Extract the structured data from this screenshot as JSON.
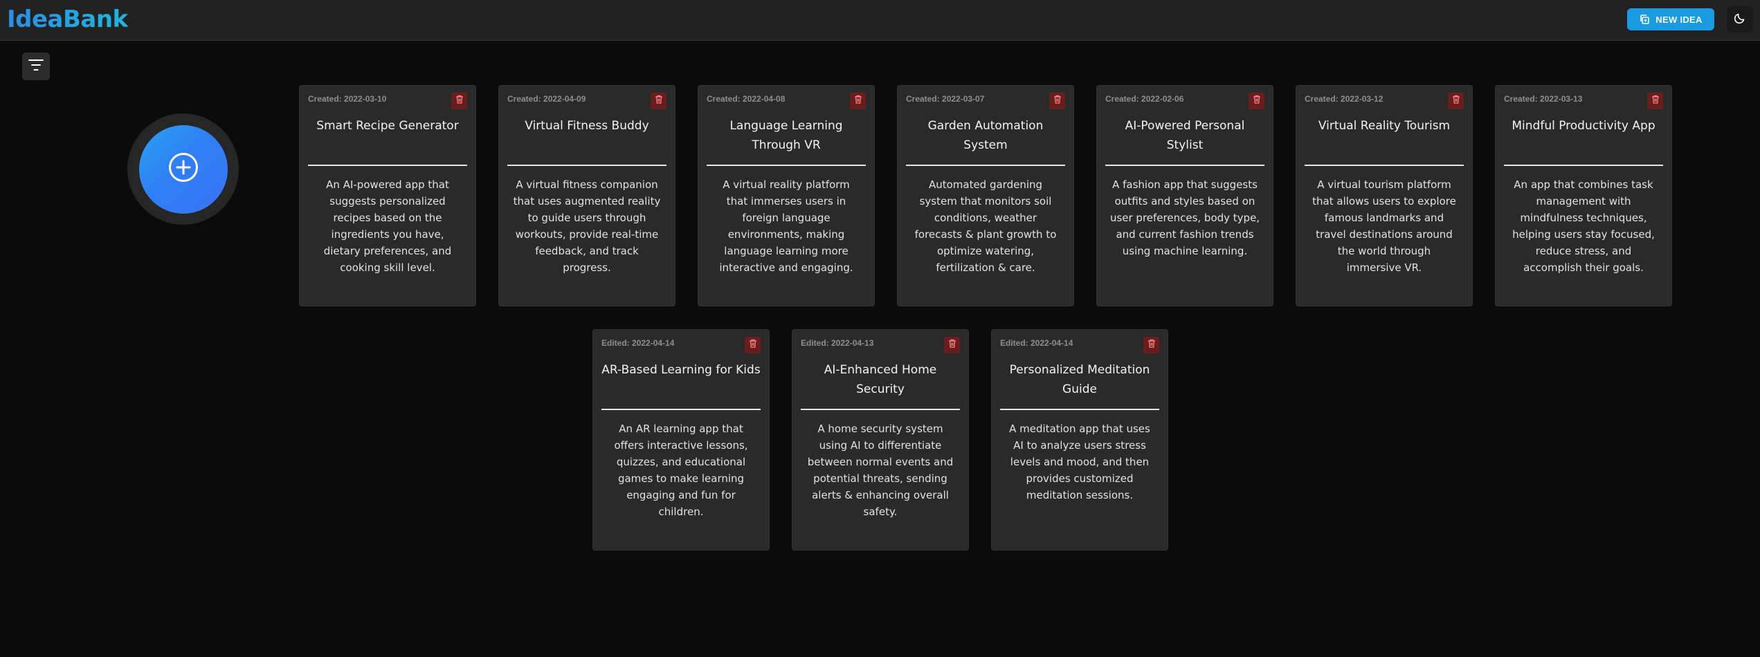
{
  "app": {
    "logo": "IdeaBank",
    "new_idea_label": "NEW IDEA",
    "icons": {
      "new_idea": "copy-plus-icon",
      "theme": "moon-icon",
      "filter": "filter-lines-icon",
      "add": "plus-circle-icon",
      "delete": "trash-icon"
    },
    "colors": {
      "accent": "#1a9ae0",
      "background": "#0b0b0b",
      "card": "#2a2a2a",
      "delete": "#6a1d1d"
    }
  },
  "ideas": [
    {
      "date": "Created: 2022-03-10",
      "title": "Smart Recipe Generator",
      "description": "An AI-powered app that suggests personalized recipes based on the ingredients you have, dietary preferences, and cooking skill level."
    },
    {
      "date": "Created: 2022-04-09",
      "title": "Virtual Fitness Buddy",
      "description": "A virtual fitness companion that uses augmented reality to guide users through workouts, provide real-time feedback, and track progress."
    },
    {
      "date": "Created: 2022-04-08",
      "title": "Language Learning Through VR",
      "description": "A virtual reality platform that immerses users in foreign language environments, making language learning more interactive and engaging."
    },
    {
      "date": "Created: 2022-03-07",
      "title": "Garden Automation System",
      "description": "Automated gardening system that monitors soil conditions, weather forecasts & plant growth to optimize watering, fertilization & care."
    },
    {
      "date": "Created: 2022-02-06",
      "title": "AI-Powered Personal Stylist",
      "description": "A fashion app that suggests outfits and styles based on user preferences, body type, and current fashion trends using machine learning."
    },
    {
      "date": "Created: 2022-03-12",
      "title": "Virtual Reality Tourism",
      "description": "A virtual tourism platform that allows users to explore famous landmarks and travel destinations around the world through immersive VR."
    },
    {
      "date": "Created: 2022-03-13",
      "title": "Mindful Productivity App",
      "description": "An app that combines task management with mindfulness techniques, helping users stay focused, reduce stress, and accomplish their goals."
    },
    {
      "date": "Edited: 2022-04-14",
      "title": "AR-Based Learning for Kids",
      "description": "An AR learning app that offers interactive lessons, quizzes, and educational games to make learning engaging and fun for children."
    },
    {
      "date": "Edited: 2022-04-13",
      "title": "AI-Enhanced Home Security",
      "description": "A home security system using AI to differentiate between normal events and potential threats, sending alerts & enhancing overall safety."
    },
    {
      "date": "Edited: 2022-04-14",
      "title": "Personalized Meditation Guide",
      "description": "A meditation app that uses AI to analyze users stress levels and mood, and then provides customized meditation sessions."
    }
  ]
}
